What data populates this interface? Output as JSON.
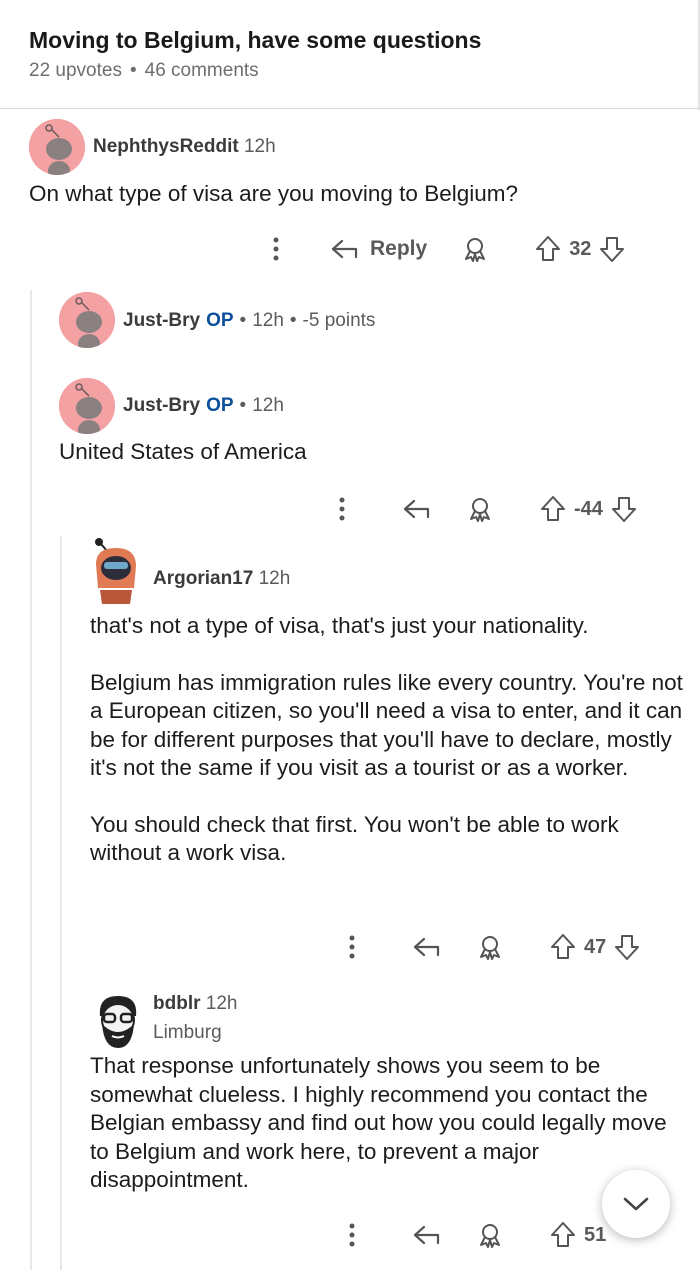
{
  "post": {
    "title": "Moving to Belgium, have some questions",
    "upvotes": "22 upvotes",
    "separator": "•",
    "comments": "46 comments"
  },
  "comments": [
    {
      "username": "NephthysReddit",
      "time": "12h",
      "text": "On what type of visa are you moving to Belgium?",
      "reply_label": "Reply",
      "score": "32"
    },
    {
      "username": "Just-Bry",
      "op_label": "OP",
      "time": "12h",
      "points": "-5 points"
    },
    {
      "username": "Just-Bry",
      "op_label": "OP",
      "time": "12h",
      "text": "United States of America",
      "score": "-44"
    },
    {
      "username": "Argorian17",
      "time": "12h",
      "paragraphs": [
        "that's not a type of visa, that's just your nationality.",
        "Belgium has immigration rules like every country. You're not a European citizen, so you'll need a visa to enter, and it can be for different purposes that you'll have to declare, mostly it's not the same if you visit as a tourist or as a worker.",
        "You should check that first. You won't be able to work without a work visa."
      ],
      "score": "47"
    },
    {
      "username": "bdblr",
      "time": "12h",
      "flair": "Limburg",
      "text": "That response unfortunately shows you seem to be somewhat clueless. I highly recommend you contact the Belgian embassy and find out how you could legally move to Belgium and work here, to prevent a major disappointment.",
      "score": "51"
    }
  ],
  "icons": {
    "more": "more-vertical-icon",
    "reply": "reply-arrow-icon",
    "award": "award-icon",
    "upvote": "upvote-arrow-icon",
    "downvote": "downvote-arrow-icon",
    "scroll": "chevron-down-icon"
  },
  "colors": {
    "avatar_pink": "#f4a1a4",
    "op_blue": "#0a4f9c",
    "muted": "#6e6e6e"
  }
}
